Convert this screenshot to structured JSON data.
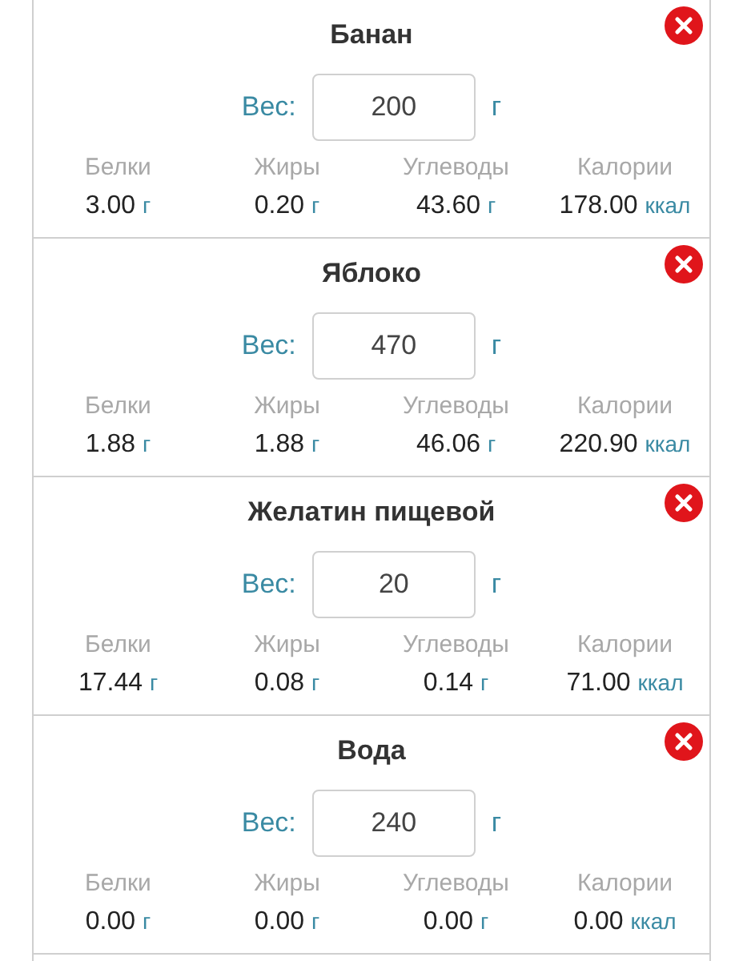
{
  "items": [
    {
      "name": "Банан",
      "weight_label": "Вес:",
      "weight": "200",
      "weight_unit": "г",
      "nutrients": [
        {
          "label": "Белки",
          "value": "3.00",
          "unit": "г"
        },
        {
          "label": "Жиры",
          "value": "0.20",
          "unit": "г"
        },
        {
          "label": "Углеводы",
          "value": "43.60",
          "unit": "г"
        },
        {
          "label": "Калории",
          "value": "178.00",
          "unit": "ккал"
        }
      ]
    },
    {
      "name": "Яблоко",
      "weight_label": "Вес:",
      "weight": "470",
      "weight_unit": "г",
      "nutrients": [
        {
          "label": "Белки",
          "value": "1.88",
          "unit": "г"
        },
        {
          "label": "Жиры",
          "value": "1.88",
          "unit": "г"
        },
        {
          "label": "Углеводы",
          "value": "46.06",
          "unit": "г"
        },
        {
          "label": "Калории",
          "value": "220.90",
          "unit": "ккал"
        }
      ]
    },
    {
      "name": "Желатин пищевой",
      "weight_label": "Вес:",
      "weight": "20",
      "weight_unit": "г",
      "nutrients": [
        {
          "label": "Белки",
          "value": "17.44",
          "unit": "г"
        },
        {
          "label": "Жиры",
          "value": "0.08",
          "unit": "г"
        },
        {
          "label": "Углеводы",
          "value": "0.14",
          "unit": "г"
        },
        {
          "label": "Калории",
          "value": "71.00",
          "unit": "ккал"
        }
      ]
    },
    {
      "name": "Вода",
      "weight_label": "Вес:",
      "weight": "240",
      "weight_unit": "г",
      "nutrients": [
        {
          "label": "Белки",
          "value": "0.00",
          "unit": "г"
        },
        {
          "label": "Жиры",
          "value": "0.00",
          "unit": "г"
        },
        {
          "label": "Углеводы",
          "value": "0.00",
          "unit": "г"
        },
        {
          "label": "Калории",
          "value": "0.00",
          "unit": "ккал"
        }
      ]
    }
  ]
}
